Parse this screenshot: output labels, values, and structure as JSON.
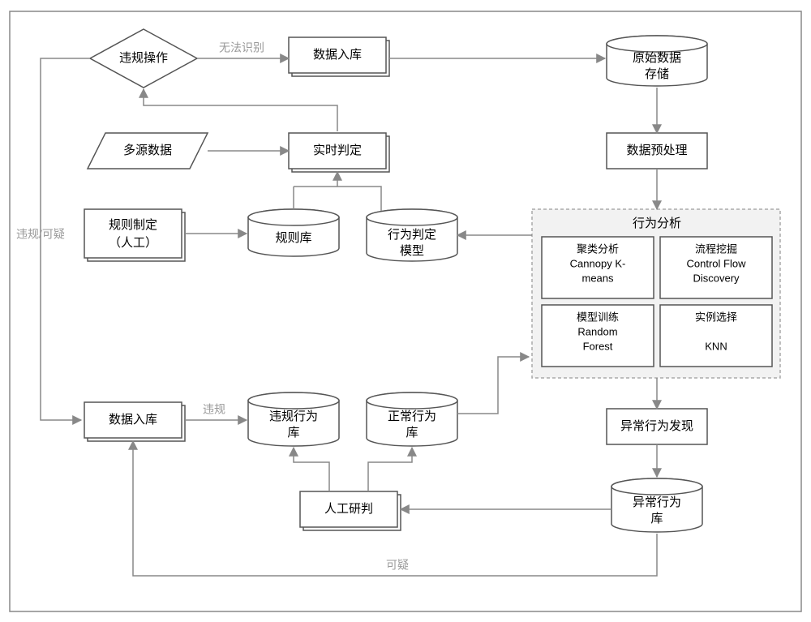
{
  "nodes": {
    "violation_op": {
      "label": "违规操作"
    },
    "data_ingest_top": {
      "label": "数据入库"
    },
    "raw_storage": {
      "label1": "原始数据",
      "label2": "存储"
    },
    "multi_source": {
      "label": "多源数据"
    },
    "realtime_judge": {
      "label": "实时判定"
    },
    "preprocess": {
      "label": "数据预处理"
    },
    "rule_making": {
      "label1": "规则制定",
      "label2": "（人工）"
    },
    "rule_db": {
      "label": "规则库"
    },
    "behavior_model": {
      "label1": "行为判定",
      "label2": "模型"
    },
    "behavior_analysis": {
      "title": "行为分析"
    },
    "analysis_cluster": {
      "label1": "聚类分析",
      "label2": "Cannopy K-",
      "label3": "means"
    },
    "analysis_process": {
      "label1": "流程挖掘",
      "label2": "Control Flow",
      "label3": "Discovery"
    },
    "analysis_train": {
      "label1": "模型训练",
      "label2": "Random",
      "label3": "Forest"
    },
    "analysis_instance": {
      "label1": "实例选择",
      "label2": "",
      "label3": "KNN"
    },
    "data_ingest_bottom": {
      "label": "数据入库"
    },
    "violation_db": {
      "label1": "违规行为",
      "label2": "库"
    },
    "normal_db": {
      "label1": "正常行为",
      "label2": "库"
    },
    "anomaly_discover": {
      "label": "异常行为发现"
    },
    "manual_review": {
      "label": "人工研判"
    },
    "anomaly_db": {
      "label1": "异常行为",
      "label2": "库"
    }
  },
  "edges": {
    "unrecognized": {
      "label": "无法识别"
    },
    "violation_suspect": {
      "label": "违规/可疑"
    },
    "violation": {
      "label": "违规"
    },
    "suspect": {
      "label": "可疑"
    }
  }
}
